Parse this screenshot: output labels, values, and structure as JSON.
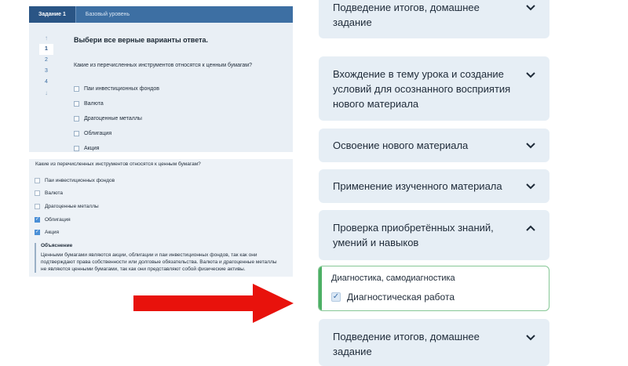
{
  "quiz": {
    "tabs": [
      "Задание 1",
      "Базовый уровень"
    ],
    "nav": {
      "up_icon": "arrow-up-icon",
      "numbers": [
        "1",
        "2",
        "3",
        "4"
      ],
      "down_icon": "arrow-down-icon"
    },
    "title": "Выбери все верные варианты ответа.",
    "question": "Какие из перечисленных инструментов относятся к ценным бумагам?",
    "options": [
      "Паи инвестиционных фондов",
      "Валюта",
      "Драгоценные металлы",
      "Облигация",
      "Акция"
    ]
  },
  "result": {
    "question": "Какие из перечисленных инструментов относятся к ценным бумагам?",
    "options": [
      {
        "label": "Паи инвестиционных фондов",
        "checked": false
      },
      {
        "label": "Валюта",
        "checked": false
      },
      {
        "label": "Драгоценные металлы",
        "checked": false
      },
      {
        "label": "Облигация",
        "checked": true
      },
      {
        "label": "Акция",
        "checked": true
      }
    ],
    "explanation_title": "Объяснение",
    "explanation_lines": [
      "Ценными бумагами являются акции, облигации и паи инвестиционных фондов, так как они",
      "подтверждают права собственности или долговые обязательства. Валюта и драгоценные металлы",
      "не являются ценными бумагами, так как они представляют собой физические активы."
    ]
  },
  "arrow": {
    "color": "#e8120c"
  },
  "accordion": {
    "items": [
      {
        "lines": [
          "Подведение итогов, домашнее",
          "задание"
        ],
        "expanded": false
      },
      {
        "lines": [
          "Вхождение в тему урока и создание",
          "условий для осознанного восприятия",
          "нового материала"
        ],
        "expanded": false
      },
      {
        "lines": [
          "Освоение нового материала"
        ],
        "expanded": false
      },
      {
        "lines": [
          "Применение изученного материала"
        ],
        "expanded": false
      },
      {
        "lines": [
          "Проверка приобретённых знаний,",
          "умений и навыков"
        ],
        "expanded": true
      },
      {
        "lines": [
          "Подведение итогов, домашнее",
          "задание"
        ],
        "expanded": false
      }
    ],
    "diagnostics": {
      "title": "Диагностика, самодиагностика",
      "item": "Диагностическая работа",
      "checked": true
    }
  },
  "colors": {
    "accordion_bg": "#e6eef5",
    "accent_green": "#4caf64",
    "quiz_header": "#3d6fa3"
  }
}
